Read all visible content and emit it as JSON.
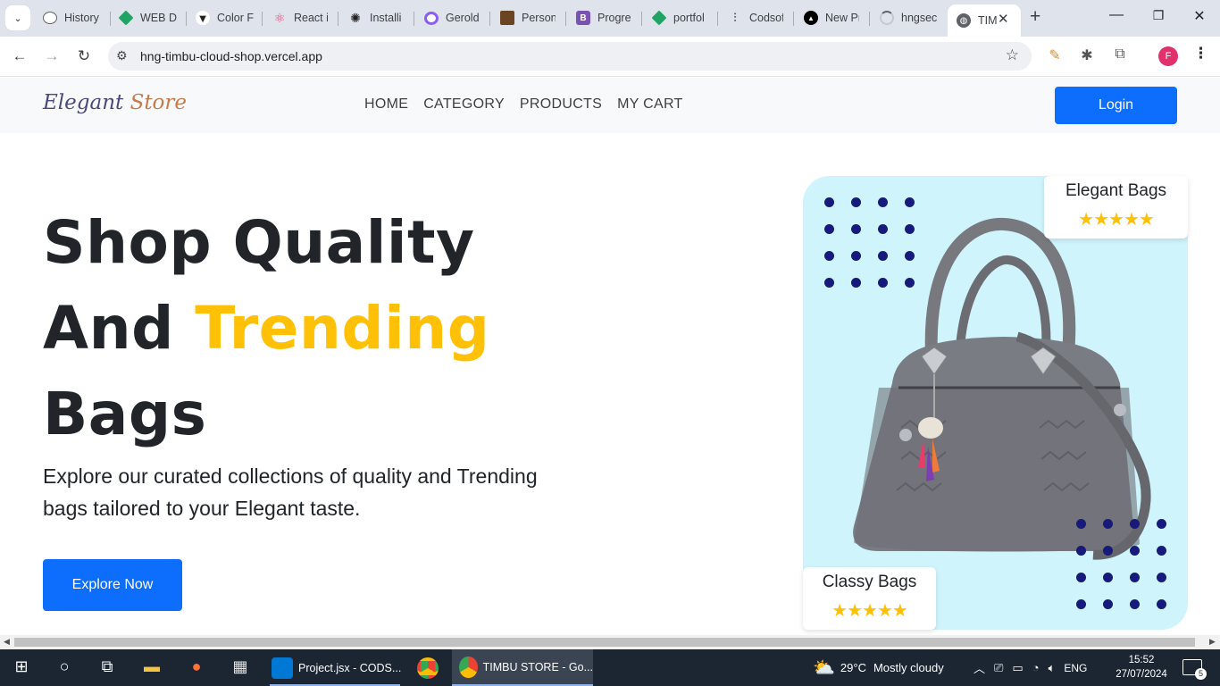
{
  "browser": {
    "tabs": [
      {
        "label": "History",
        "icon": "history-icon",
        "color": "#5f6368"
      },
      {
        "label": "WEB D",
        "icon": "google-drive-icon",
        "color": "#1fa463"
      },
      {
        "label": "Color F",
        "icon": "color-picker-icon",
        "color": "#222222"
      },
      {
        "label": "React ic",
        "icon": "react-icon",
        "color": "#e0457b"
      },
      {
        "label": "Installi",
        "icon": "openai-icon",
        "color": "#222222"
      },
      {
        "label": "Gerold",
        "icon": "gerold-icon",
        "color": "#8b5cf6"
      },
      {
        "label": "Persona",
        "icon": "portrait-icon",
        "color": "#6b4423"
      },
      {
        "label": "Progre",
        "icon": "bootstrap-icon",
        "color": "#7952b3"
      },
      {
        "label": "portfol",
        "icon": "google-drive-icon",
        "color": "#1fa463"
      },
      {
        "label": "Codsof",
        "icon": "sliders-icon",
        "color": "#555555"
      },
      {
        "label": "New Pr",
        "icon": "vercel-icon",
        "color": "#000000"
      },
      {
        "label": "hngsec",
        "icon": "loading-icon",
        "color": "#9aa0a6"
      }
    ],
    "active_tab": {
      "label": "TIM",
      "icon": "globe-icon"
    },
    "url": "hng-timbu-cloud-shop.vercel.app",
    "profile_initial": "F"
  },
  "site": {
    "brand_part1": "Elegant",
    "brand_part2": "Store",
    "nav": [
      "HOME",
      "CATEGORY",
      "PRODUCTS",
      "MY CART"
    ],
    "login_label": "Login"
  },
  "hero": {
    "title_line1": "Shop Quality",
    "title_line2_a": "And",
    "title_line2_b": "Trending",
    "title_line3": "Bags",
    "subtitle": "Explore our curated collections of quality and Trending bags tailored to your Elegant taste.",
    "cta": "Explore Now",
    "badge_top": {
      "title": "Elegant Bags",
      "stars": "★★★★★",
      "rating": 5
    },
    "badge_bottom": {
      "title": "Classy Bags",
      "stars": "★★★★★",
      "rating": 5
    }
  },
  "taskbar": {
    "apps": [
      {
        "label": "Project.jsx - CODS...",
        "icon": "vscode-icon"
      },
      {
        "label": "TIMBU STORE - Go...",
        "icon": "chrome-icon"
      }
    ],
    "weather_temp": "29°C",
    "weather_desc": "Mostly cloudy",
    "lang": "ENG",
    "time": "15:52",
    "date": "27/07/2024",
    "notifications": "5"
  },
  "colors": {
    "primary": "#0d6efd",
    "accent": "#ffc107",
    "hero_bg": "#cff4fc",
    "dots": "#171a7a"
  }
}
